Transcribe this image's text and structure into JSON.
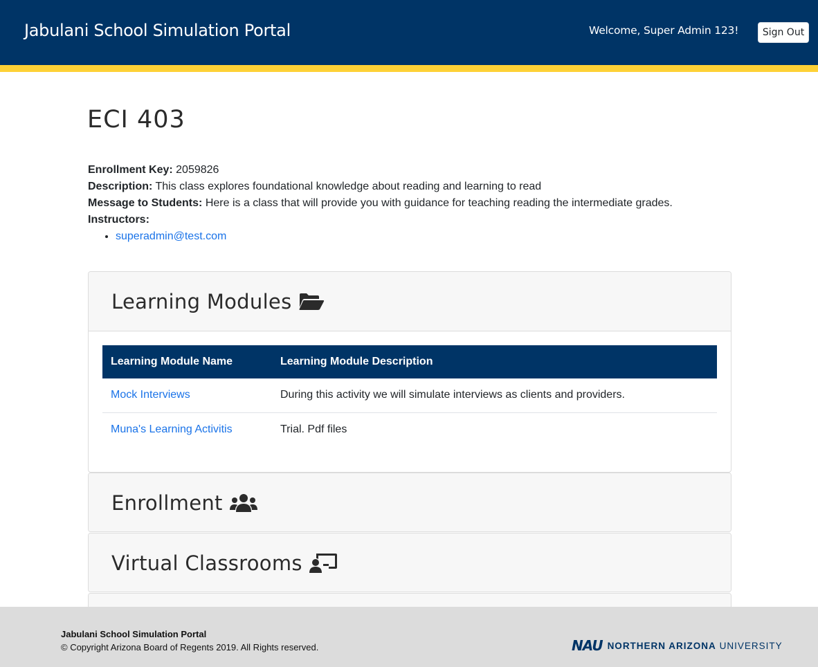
{
  "header": {
    "brand": "Jabulani School Simulation Portal",
    "welcome": "Welcome, Super Admin 123!",
    "signout_label": "Sign Out"
  },
  "course": {
    "title": "ECI 403",
    "enrollment_key_label": "Enrollment Key:",
    "enrollment_key": "2059826",
    "description_label": "Description:",
    "description": "This class explores foundational knowledge about reading and learning to read",
    "message_label": "Message to Students:",
    "message": "Here is a class that will provide you with guidance for teaching reading the intermediate grades.",
    "instructors_label": "Instructors:",
    "instructors": [
      "superadmin@test.com"
    ]
  },
  "learning_modules": {
    "title": "Learning Modules",
    "icon": "folder-open-icon",
    "columns": [
      "Learning Module Name",
      "Learning Module Description"
    ],
    "rows": [
      {
        "name": "Mock Interviews",
        "description": "During this activity we will simulate interviews as clients and providers."
      },
      {
        "name": "Muna's Learning Activitis",
        "description": "Trial. Pdf files"
      }
    ]
  },
  "enrollment": {
    "title": "Enrollment",
    "icon": "users-icon"
  },
  "virtual_classrooms": {
    "title": "Virtual Classrooms",
    "icon": "chalkboard-teacher-icon"
  },
  "footer": {
    "title": "Jabulani School Simulation Portal",
    "copyright": "© Copyright Arizona Board of Regents 2019. All Rights reserved.",
    "logo_mark": "NAU",
    "logo_text_bold": "NORTHERN ARIZONA",
    "logo_text_regular": "UNIVERSITY"
  },
  "colors": {
    "header_bg": "#003466",
    "accent": "#fed136",
    "link": "#1a73e8",
    "footer_bg": "#dcdcdc"
  }
}
